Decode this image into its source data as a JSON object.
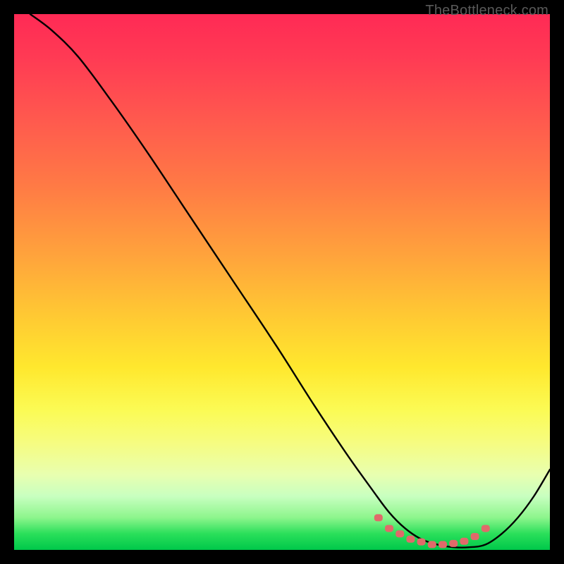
{
  "attribution_label": "TheBottleneck.com",
  "chart_data": {
    "type": "line",
    "title": "",
    "xlabel": "",
    "ylabel": "",
    "xlim": [
      0,
      100
    ],
    "ylim": [
      0,
      100
    ],
    "series": [
      {
        "name": "curve",
        "x": [
          3,
          7,
          12,
          18,
          25,
          33,
          41,
          49,
          56,
          62,
          67,
          70,
          73,
          76,
          79,
          82,
          85,
          88,
          91,
          94,
          97,
          100
        ],
        "values": [
          100,
          97,
          92,
          84,
          74,
          62,
          50,
          38,
          27,
          18,
          11,
          7,
          4,
          2,
          1,
          0.5,
          0.5,
          1,
          3,
          6,
          10,
          15
        ]
      }
    ],
    "markers": {
      "name": "best-range-dots",
      "color": "#e06a6a",
      "x": [
        68,
        70,
        72,
        74,
        76,
        78,
        80,
        82,
        84,
        86,
        88
      ],
      "values": [
        6,
        4,
        3,
        2,
        1.5,
        1,
        1,
        1.2,
        1.6,
        2.5,
        4
      ]
    },
    "background_gradient_stops": [
      {
        "pos": 0,
        "color": "#ff2a55"
      },
      {
        "pos": 20,
        "color": "#ff5a4e"
      },
      {
        "pos": 45,
        "color": "#ffa33c"
      },
      {
        "pos": 66,
        "color": "#ffe82e"
      },
      {
        "pos": 86,
        "color": "#e8ffb0"
      },
      {
        "pos": 100,
        "color": "#00c84a"
      }
    ]
  }
}
